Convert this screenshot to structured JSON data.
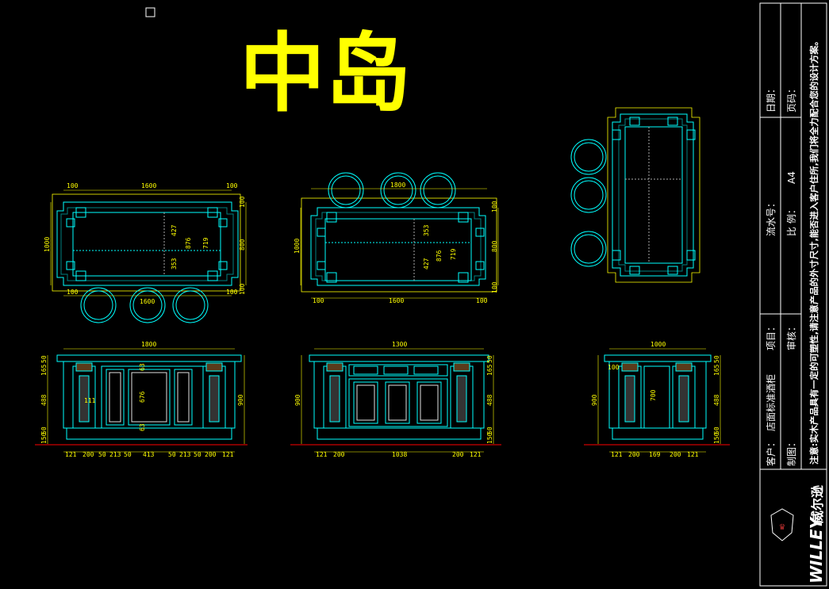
{
  "drawing": {
    "title": "中岛",
    "colors": {
      "background": "#000000",
      "title": "#ffff00",
      "lines": "#00ffff",
      "dims": "#ffff00",
      "ground": "#ff0000",
      "border": "#ffffff"
    },
    "plan1": {
      "top_dims": [
        "100",
        "1600",
        "100"
      ],
      "left_dim": "1000",
      "right_dims": [
        "100",
        "800",
        "100"
      ],
      "inner_dims": [
        "427",
        "876",
        "719",
        "353"
      ],
      "bottom_dims": [
        "100",
        "1600",
        "100"
      ]
    },
    "plan2": {
      "top_dim": "1800",
      "left_dim": "1000",
      "right_dims": [
        "100",
        "800",
        "100"
      ],
      "inner_dims": [
        "353",
        "876",
        "719",
        "427"
      ],
      "bottom_dims": [
        "100",
        "1600",
        "100"
      ]
    },
    "elev1": {
      "top_dim": "1800",
      "left_dims": [
        "50",
        "165",
        "488",
        "50",
        "150"
      ],
      "right_dim": "900",
      "inner_dims": [
        "63",
        "676",
        "63",
        "111"
      ],
      "bottom_dims": [
        "121",
        "200",
        "50",
        "213",
        "50",
        "413",
        "50",
        "213",
        "50",
        "200",
        "121"
      ]
    },
    "elev2": {
      "top_dim": "1300",
      "left_dim": "900",
      "right_dims": [
        "50",
        "165",
        "488",
        "50",
        "150"
      ],
      "bottom_dims": [
        "121",
        "200",
        "1038",
        "200",
        "121"
      ]
    },
    "elev3": {
      "top_dim": "1000",
      "left_dims": [
        "100"
      ],
      "left_total": "900",
      "inner_dim": "700",
      "right_dims": [
        "50",
        "165",
        "488",
        "50",
        "150"
      ],
      "bottom_dims": [
        "121",
        "200",
        "169",
        "200",
        "121"
      ]
    }
  },
  "title_block": {
    "client_label": "客户：",
    "project_label": "店面标准酒柜",
    "item_label": "项目：",
    "drawn_label": "制图：",
    "review_label": "审核：",
    "serial_label": "流水号：",
    "scale_label": "比 例：",
    "scale_value": "A4",
    "date_label": "日期：",
    "page_label": "页码：",
    "note": "注意:实木产品具有一定的可塑性,请注意产品的外寸尺寸,能否进入客户住所,我们将全力配合您的设计方案。",
    "brand_en": "WILLEY",
    "brand_cn": "威尔逊"
  }
}
